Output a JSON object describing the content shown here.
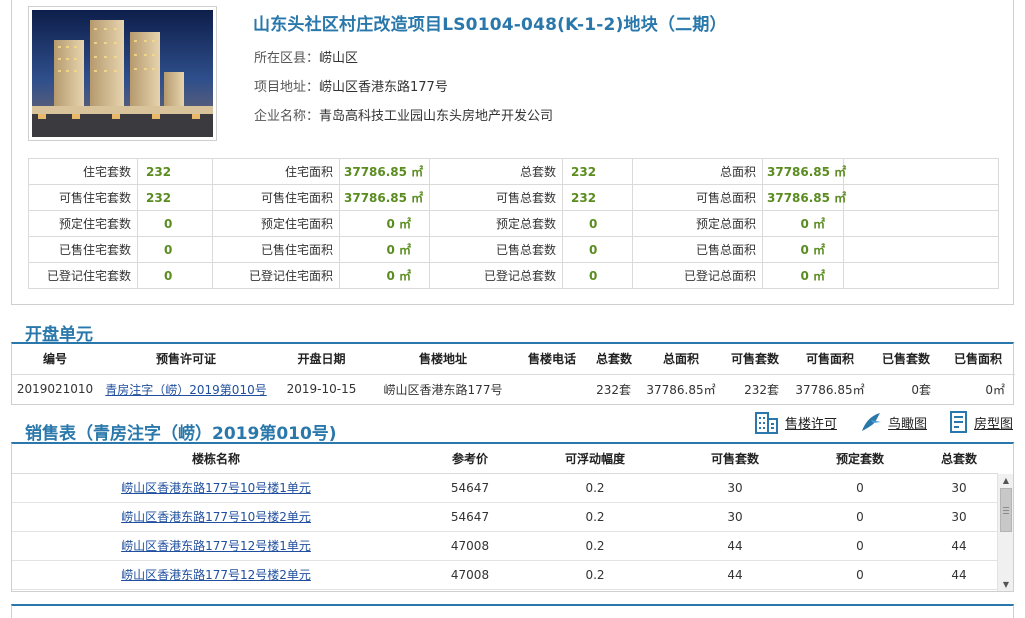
{
  "project": {
    "title": "山东头社区村庄改造项目LS0104-048(K-1-2)地块（二期）",
    "district_label": "所在区县：",
    "district": "崂山区",
    "address_label": "项目地址：",
    "address": "崂山区香港东路177号",
    "company_label": "企业名称：",
    "company": "青岛高科技工业园山东头房地产开发公司"
  },
  "stats": [
    [
      {
        "label": "住宅套数",
        "value": "232"
      },
      {
        "label": "住宅面积",
        "value": "37786.85 ㎡"
      },
      {
        "label": "总套数",
        "value": "232"
      },
      {
        "label": "总面积",
        "value": "37786.85 ㎡"
      }
    ],
    [
      {
        "label": "可售住宅套数",
        "value": "232"
      },
      {
        "label": "可售住宅面积",
        "value": "37786.85 ㎡"
      },
      {
        "label": "可售总套数",
        "value": "232"
      },
      {
        "label": "可售总面积",
        "value": "37786.85 ㎡"
      }
    ],
    [
      {
        "label": "预定住宅套数",
        "value": "0"
      },
      {
        "label": "预定住宅面积",
        "value": "0 ㎡"
      },
      {
        "label": "预定总套数",
        "value": "0"
      },
      {
        "label": "预定总面积",
        "value": "0 ㎡"
      }
    ],
    [
      {
        "label": "已售住宅套数",
        "value": "0"
      },
      {
        "label": "已售住宅面积",
        "value": "0 ㎡"
      },
      {
        "label": "已售总套数",
        "value": "0"
      },
      {
        "label": "已售总面积",
        "value": "0 ㎡"
      }
    ],
    [
      {
        "label": "已登记住宅套数",
        "value": "0"
      },
      {
        "label": "已登记住宅面积",
        "value": "0 ㎡"
      },
      {
        "label": "已登记总套数",
        "value": "0"
      },
      {
        "label": "已登记总面积",
        "value": "0 ㎡"
      }
    ]
  ],
  "units_section": {
    "title": "开盘单元",
    "headers": [
      "编号",
      "预售许可证",
      "开盘日期",
      "售楼地址",
      "售楼电话",
      "总套数",
      "总面积",
      "可售套数",
      "可售面积",
      "已售套数",
      "已售面积"
    ],
    "rows": [
      [
        "2019021010",
        "青房注字（崂）2019第010号",
        "2019-10-15",
        "崂山区香港东路177号",
        "",
        "232套",
        "37786.85㎡",
        "232套",
        "37786.85㎡",
        "0套",
        "0㎡"
      ]
    ]
  },
  "sales_section": {
    "title": "销售表（青房注字（崂）2019第010号)",
    "tools": {
      "permit": "售楼许可",
      "aerial": "鸟瞰图",
      "floorplan": "房型图"
    },
    "headers": [
      "楼栋名称",
      "参考价",
      "可浮动幅度",
      "可售套数",
      "预定套数",
      "总套数"
    ],
    "rows": [
      [
        "崂山区香港东路177号10号楼1单元",
        "54647",
        "0.2",
        "30",
        "0",
        "30"
      ],
      [
        "崂山区香港东路177号10号楼2单元",
        "54647",
        "0.2",
        "30",
        "0",
        "30"
      ],
      [
        "崂山区香港东路177号12号楼1单元",
        "47008",
        "0.2",
        "44",
        "0",
        "44"
      ],
      [
        "崂山区香港东路177号12号楼2单元",
        "47008",
        "0.2",
        "44",
        "0",
        "44"
      ]
    ]
  },
  "colors": {
    "accent": "#2a78ab",
    "value_green": "#5a8c20",
    "link": "#1f4f9e"
  }
}
